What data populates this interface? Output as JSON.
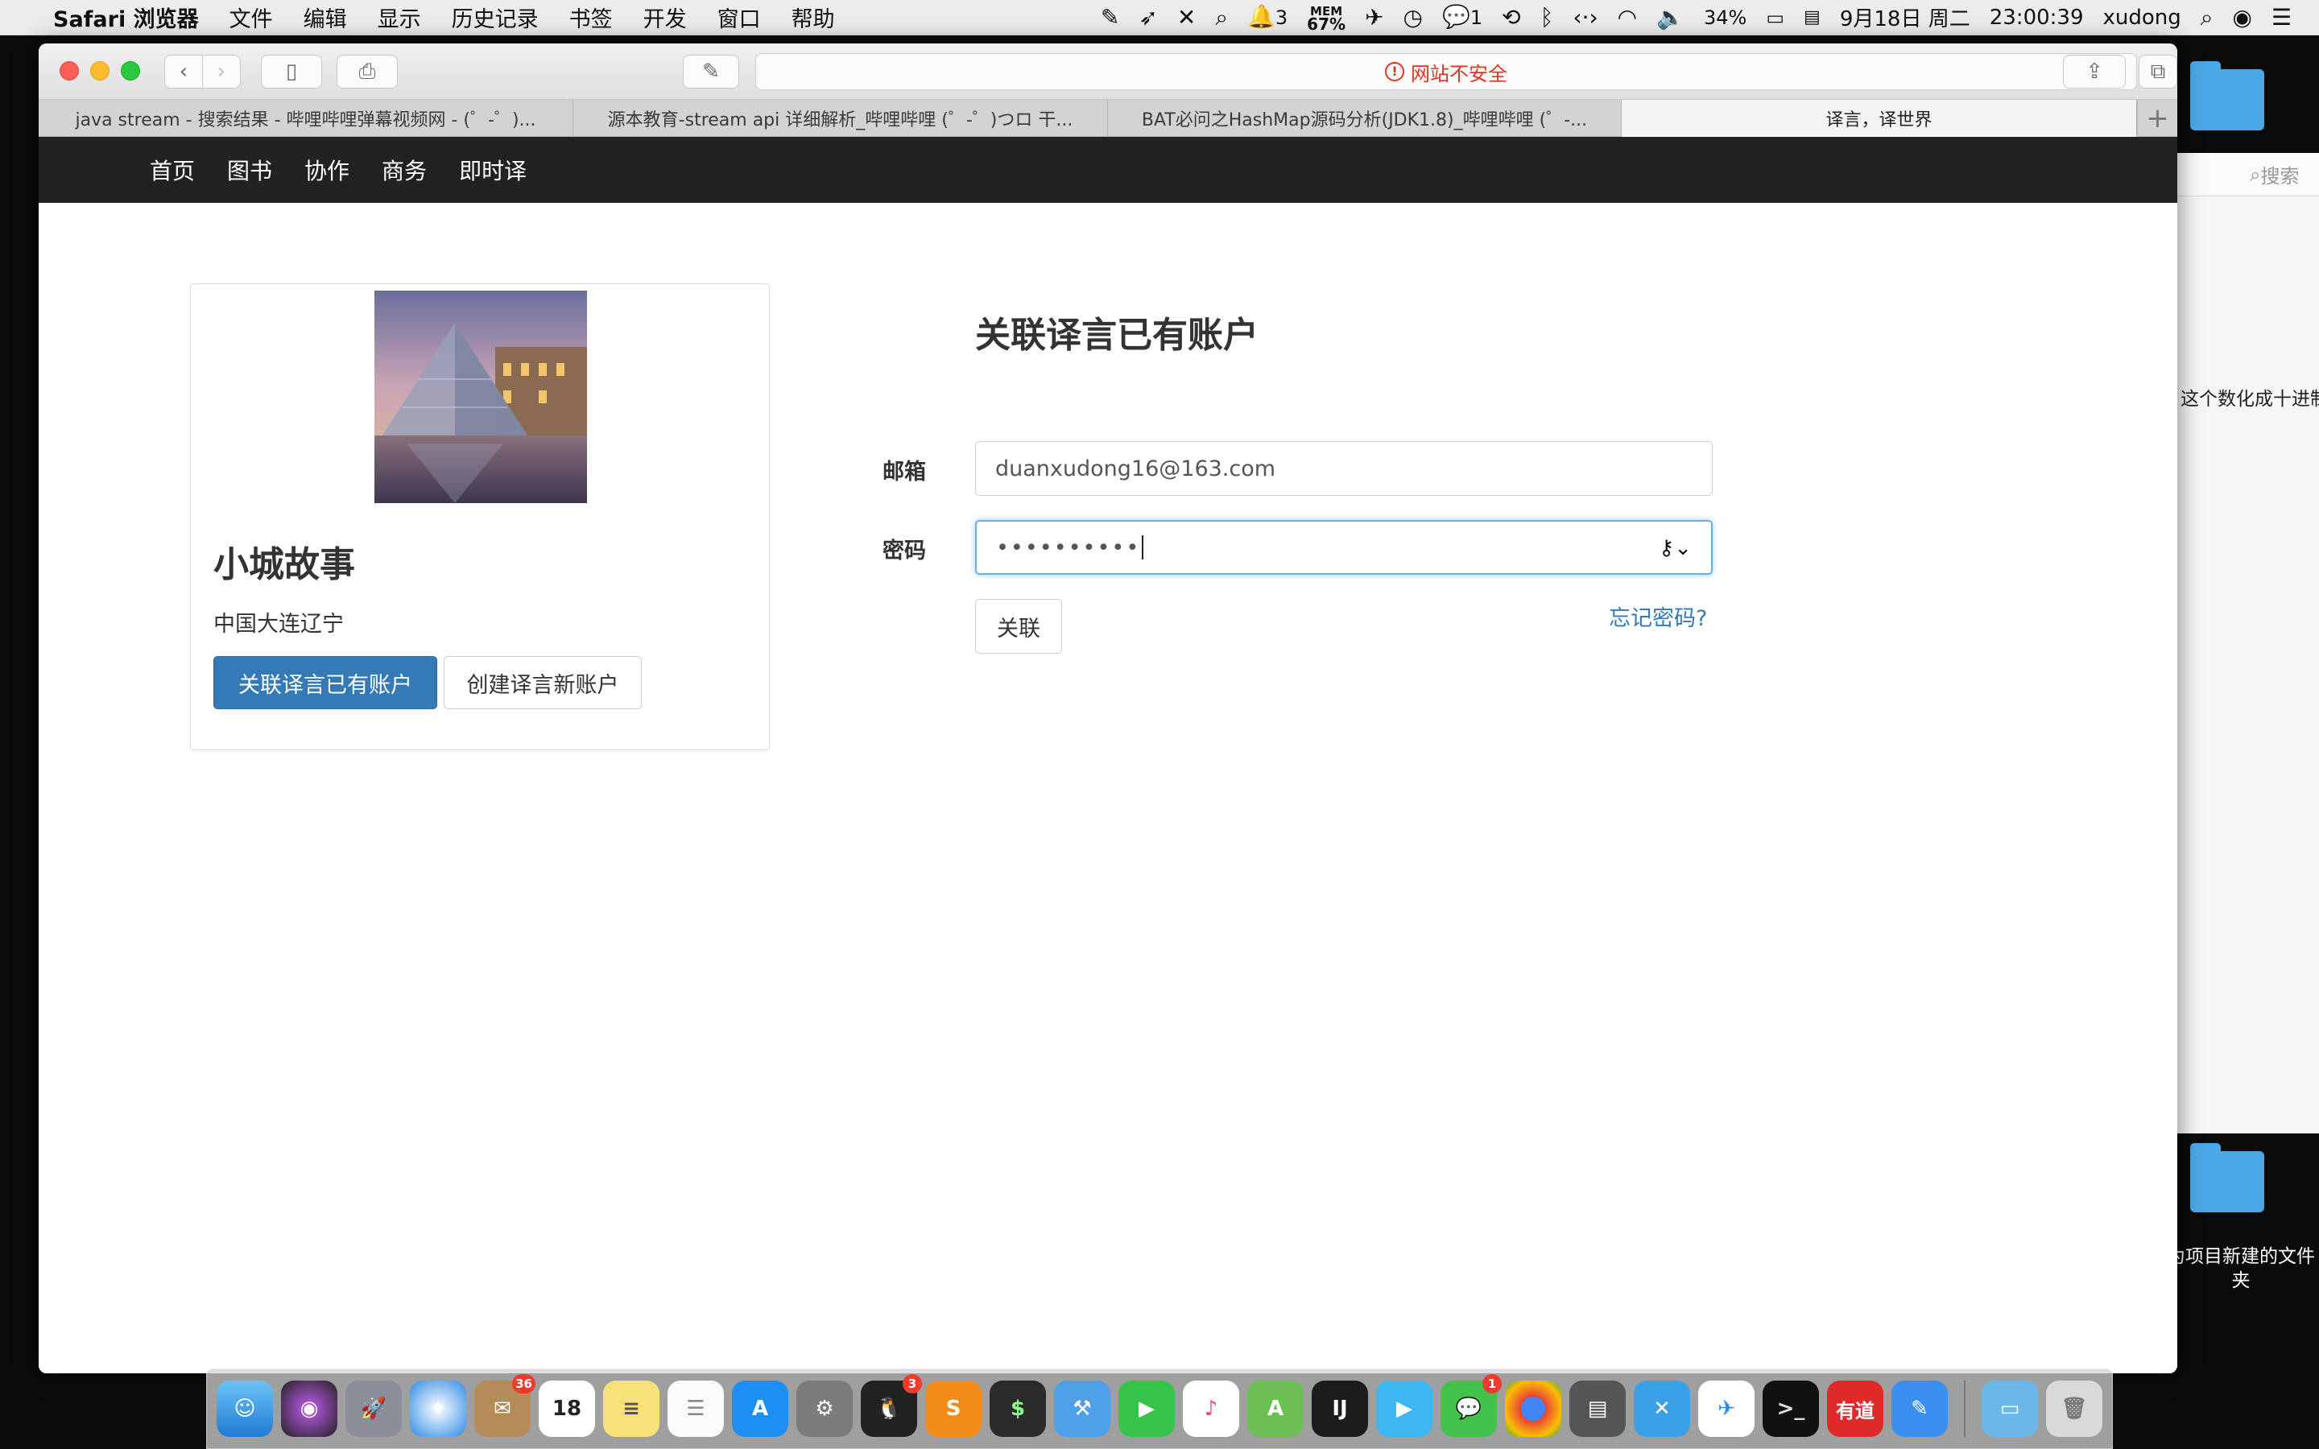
{
  "menubar": {
    "app_name": "Safari 浏览器",
    "items": [
      "文件",
      "编辑",
      "显示",
      "历史记录",
      "书签",
      "开发",
      "窗口",
      "帮助"
    ],
    "mem_label": "MEM",
    "mem_value": "67%",
    "qq_count": "3",
    "wechat_count": "1",
    "battery": "34%",
    "date": "9月18日 周二",
    "time": "23:00:39",
    "user": "xudong"
  },
  "browser": {
    "address_text": "网站不安全",
    "tabs": [
      {
        "label": "java stream - 搜索结果 - 哔哩哔哩弹幕视频网 - (゜-゜)..."
      },
      {
        "label": "源本教育-stream api 详细解析_哔哩哔哩 (゜-゜)つロ 干..."
      },
      {
        "label": "BAT必问之HashMap源码分析(JDK1.8)_哔哩哔哩 (゜-..."
      },
      {
        "label": "译言，译世界"
      }
    ]
  },
  "nav": {
    "items": [
      "首页",
      "图书",
      "协作",
      "商务",
      "即时译"
    ]
  },
  "profile": {
    "name": "小城故事",
    "location": "中国大连辽宁",
    "link_button": "关联译言已有账户",
    "create_button": "创建译言新账户"
  },
  "form": {
    "title": "关联译言已有账户",
    "email_label": "邮箱",
    "email_value": "duanxudong16@163.com",
    "password_label": "密码",
    "password_mask": "••••••••••",
    "submit_label": "关联",
    "forgot_label": "忘记密码?"
  },
  "desktop": {
    "search_placeholder": "搜索",
    "partial_text": "这个数化成十进制",
    "folder_label": "为项目新建的文件夹"
  },
  "dock": {
    "badges": {
      "mail": "36",
      "calendar_day": "18",
      "qq": "3",
      "wechat": "1"
    },
    "youdao_label": "有道"
  }
}
